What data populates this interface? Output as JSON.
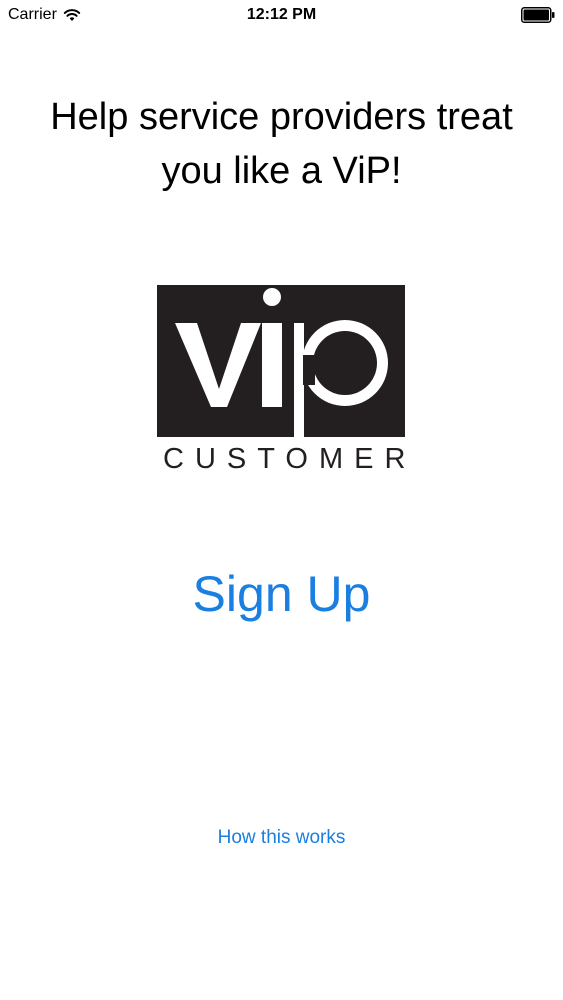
{
  "status_bar": {
    "carrier": "Carrier",
    "time": "12:12 PM",
    "wifi_icon": "wifi-icon",
    "battery_icon": "battery-icon",
    "battery_level": 1.0
  },
  "headline": {
    "line1": "Help service providers treat",
    "line2": "you like a ViP!"
  },
  "logo": {
    "mark": "vip",
    "subtitle": "CUSTOMER",
    "box_color": "#231f20",
    "mark_color": "#ffffff"
  },
  "actions": {
    "signup_label": "Sign Up",
    "how_label": "How this works",
    "link_color": "#1a7fe0"
  }
}
